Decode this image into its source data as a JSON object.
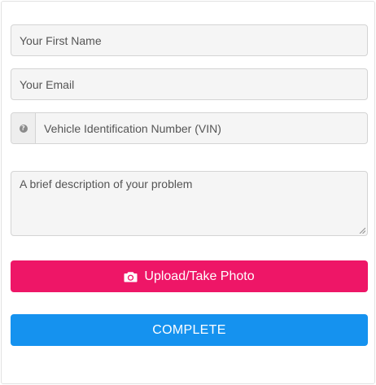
{
  "form": {
    "first_name_placeholder": "Your First Name",
    "email_placeholder": "Your Email",
    "vin_placeholder": "Vehicle Identification Number (VIN)",
    "vin_help_icon": "question-circle-icon",
    "vin_help_glyph": "?",
    "description_placeholder": "A brief description of your problem",
    "upload_label": "Upload/Take Photo",
    "upload_icon": "camera-icon",
    "complete_label": "COMPLETE"
  },
  "colors": {
    "upload_button": "#ee1667",
    "complete_button": "#1592ef",
    "field_background": "#f5f5f5",
    "field_border": "#d4d4d4"
  }
}
